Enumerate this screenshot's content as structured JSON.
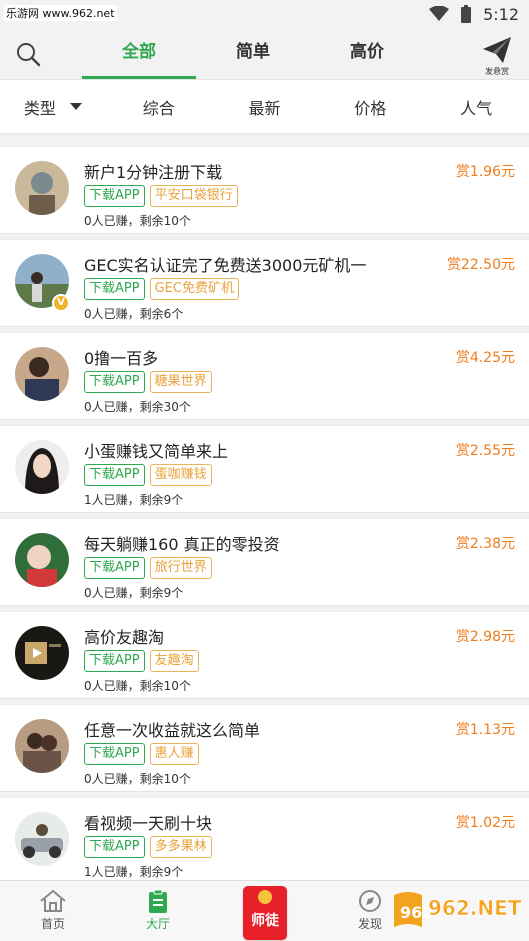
{
  "status_bar": {
    "watermark": "乐游网 www.962.net",
    "time": "5:12"
  },
  "top_nav": {
    "tabs": [
      {
        "label": "全部"
      },
      {
        "label": "简单"
      },
      {
        "label": "高价"
      }
    ],
    "publish_label": "发悬赏"
  },
  "filter": {
    "type_label": "类型",
    "options": [
      {
        "label": "综合"
      },
      {
        "label": "最新"
      },
      {
        "label": "价格"
      },
      {
        "label": "人气"
      }
    ]
  },
  "tasks": [
    {
      "title": "新户1分钟注册下载",
      "reward": "赏1.96元",
      "tags": [
        "下载APP",
        "平安口袋银行"
      ],
      "meta": "0人已赚，剩余10个"
    },
    {
      "title": "GEC实名认证完了免费送3000元矿机一",
      "reward": "赏22.50元",
      "tags": [
        "下载APP",
        "GEC免费矿机"
      ],
      "meta": "0人已赚，剩余6个"
    },
    {
      "title": "0撸一百多",
      "reward": "赏4.25元",
      "tags": [
        "下载APP",
        "糖果世界"
      ],
      "meta": "0人已赚，剩余30个"
    },
    {
      "title": "小蛋赚钱又简单来上",
      "reward": "赏2.55元",
      "tags": [
        "下载APP",
        "蛋咖赚钱"
      ],
      "meta": "1人已赚，剩余9个"
    },
    {
      "title": "每天躺赚160 真正的零投资",
      "reward": "赏2.38元",
      "tags": [
        "下载APP",
        "旅行世界"
      ],
      "meta": "0人已赚，剩余9个"
    },
    {
      "title": "高价友趣淘",
      "reward": "赏2.98元",
      "tags": [
        "下载APP",
        "友趣淘"
      ],
      "meta": "0人已赚，剩余10个"
    },
    {
      "title": "任意一次收益就这么简单",
      "reward": "赏1.13元",
      "tags": [
        "下载APP",
        "惠人赚"
      ],
      "meta": "0人已赚，剩余10个"
    },
    {
      "title": "看视频一天刷十块",
      "reward": "赏1.02元",
      "tags": [
        "下载APP",
        "多多果林"
      ],
      "meta": "1人已赚，剩余9个"
    }
  ],
  "bottom_nav": {
    "home": "首页",
    "hall": "大厅",
    "center": "师徒",
    "discover": "发现",
    "watermark": "962.NET 乐游网"
  },
  "colors": {
    "accent_green": "#2fa84f",
    "reward_orange": "#f07c1c",
    "tag_orange": "#e8a23a",
    "envelope_red": "#e8202a"
  }
}
